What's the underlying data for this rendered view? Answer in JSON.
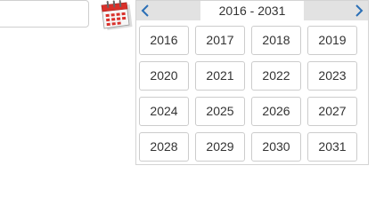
{
  "date_input": {
    "value": "",
    "placeholder": ""
  },
  "calendar_button": {
    "icon": "calendar-icon"
  },
  "picker": {
    "range_title": "2016 - 2031",
    "prev_icon": "chevron-left-icon",
    "next_icon": "chevron-right-icon",
    "years": [
      "2016",
      "2017",
      "2018",
      "2019",
      "2020",
      "2021",
      "2022",
      "2023",
      "2024",
      "2025",
      "2026",
      "2027",
      "2028",
      "2029",
      "2030",
      "2031"
    ]
  },
  "colors": {
    "nav_bg": "#e2e2e2",
    "arrow": "#2a6fb6",
    "cell_border": "#cccccc",
    "text": "#333333"
  }
}
